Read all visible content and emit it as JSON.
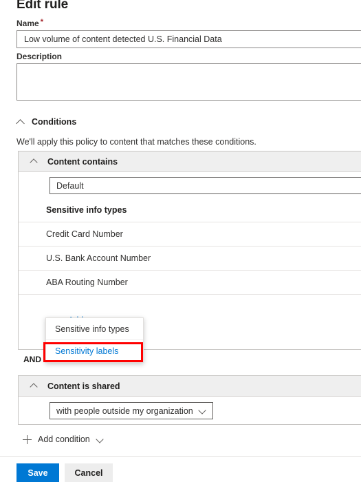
{
  "page": {
    "title": "Edit rule"
  },
  "form": {
    "name_label": "Name",
    "name_required_mark": "*",
    "name_value": "Low volume of content detected U.S. Financial Data",
    "description_label": "Description",
    "description_value": ""
  },
  "conditions": {
    "section_title": "Conditions",
    "helper_text": "We'll apply this policy to content that matches these conditions.",
    "groups": [
      {
        "header": "Content contains",
        "select_value": "Default",
        "table_header": "Sensitive info types",
        "items": [
          "Credit Card Number",
          "U.S. Bank Account Number",
          "ABA Routing Number"
        ],
        "add_label": "Add"
      },
      {
        "header": "Content is shared",
        "select_value": "with people outside my organization"
      }
    ],
    "operator": "AND",
    "add_condition_label": "Add condition"
  },
  "add_menu": {
    "items": [
      {
        "label": "Sensitive info types",
        "highlighted": false
      },
      {
        "label": "Sensitivity labels",
        "highlighted": true
      }
    ]
  },
  "footer": {
    "save_label": "Save",
    "cancel_label": "Cancel"
  },
  "colors": {
    "accent": "#0078d4",
    "highlight": "#ff0000",
    "required": "#a4262c",
    "header_bg": "#efefef",
    "border": "#c8c6c4"
  }
}
